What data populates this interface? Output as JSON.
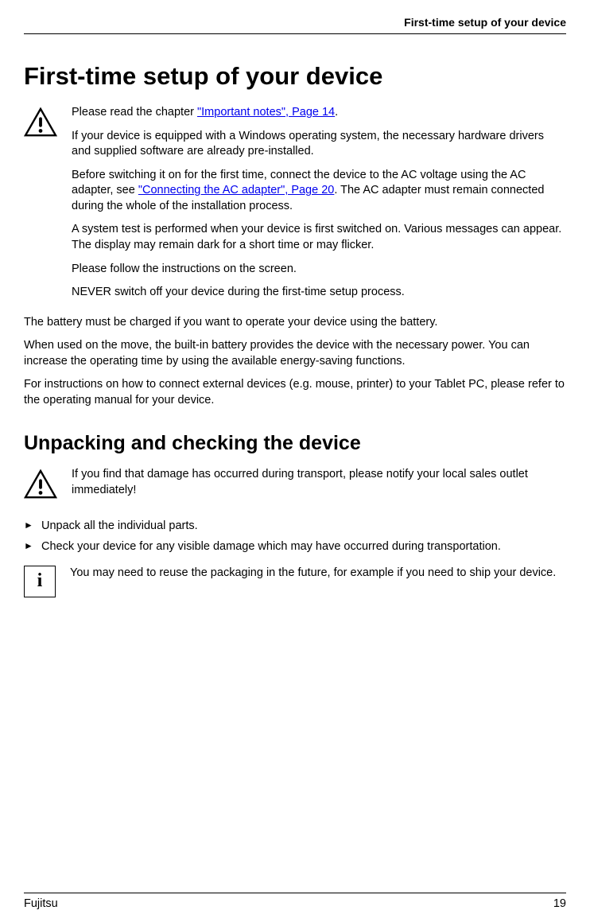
{
  "header": {
    "running_title": "First-time setup of your device"
  },
  "title": "First-time setup of your device",
  "warning1": {
    "p1_before": "Please read the chapter ",
    "p1_link": "\"Important notes\", Page 14",
    "p1_after": ".",
    "p2": "If your device is equipped with a Windows operating system, the necessary hardware drivers and supplied software are already pre-installed.",
    "p3_before": "Before switching it on for the first time, connect the device to the AC voltage using the AC adapter, see ",
    "p3_link": "\"Connecting the AC adapter\", Page 20",
    "p3_after": ". The AC adapter must remain connected during the whole of the installation process.",
    "p4": "A system test is performed when your device is first switched on. Various messages can appear. The display may remain dark for a short time or may flicker.",
    "p5": "Please follow the instructions on the screen.",
    "p6": "NEVER switch off your device during the first-time setup process."
  },
  "body": {
    "p1": "The battery must be charged if you want to operate your device using the battery.",
    "p2": "When used on the move, the built-in battery provides the device with the necessary power. You can increase the operating time by using the available energy-saving functions.",
    "p3": "For instructions on how to connect external devices (e.g. mouse, printer) to your Tablet PC, please refer to the operating manual for your device."
  },
  "section2": {
    "title": "Unpacking and checking the device",
    "warning": "If you find that damage has occurred during transport, please notify your local sales outlet immediately!",
    "steps": [
      "Unpack all the individual parts.",
      "Check your device for any visible damage which may have occurred during transportation."
    ],
    "info": "You may need to reuse the packaging in the future, for example if you need to ship your device."
  },
  "footer": {
    "left": "Fujitsu",
    "right": "19"
  }
}
